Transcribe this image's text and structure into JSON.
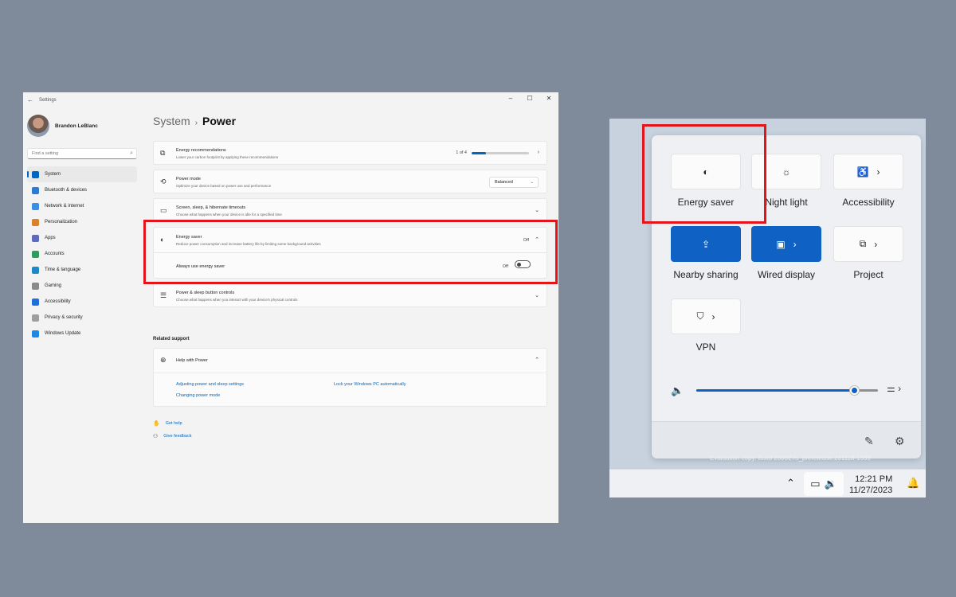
{
  "settings": {
    "window_title": "Settings",
    "window_controls": [
      "–",
      "☐",
      "✕"
    ],
    "user_name": "Brandon LeBlanc",
    "search_placeholder": "Find a setting",
    "nav": [
      {
        "label": "System",
        "color": "#0067c0"
      },
      {
        "label": "Bluetooth & devices",
        "color": "#2b7bd6"
      },
      {
        "label": "Network & internet",
        "color": "#3a8ee6"
      },
      {
        "label": "Personalization",
        "color": "#d9822b"
      },
      {
        "label": "Apps",
        "color": "#5c6bc0"
      },
      {
        "label": "Accounts",
        "color": "#2e9c5a"
      },
      {
        "label": "Time & language",
        "color": "#1e88c7"
      },
      {
        "label": "Gaming",
        "color": "#8a8a8a"
      },
      {
        "label": "Accessibility",
        "color": "#1e6fd9"
      },
      {
        "label": "Privacy & security",
        "color": "#9e9e9e"
      },
      {
        "label": "Windows Update",
        "color": "#1e88e5"
      }
    ],
    "breadcrumb": {
      "parent": "System",
      "current": "Power"
    },
    "cards": {
      "energy_recs": {
        "title": "Energy recommendations",
        "subtitle": "Lower your carbon footprint by applying these recommendations",
        "progress_text": "1 of 4",
        "progress_fraction": 0.25
      },
      "power_mode": {
        "title": "Power mode",
        "subtitle": "Optimize your device based on power use and performance",
        "value": "Balanced"
      },
      "screen_sleep": {
        "title": "Screen, sleep, & hibernate timeouts",
        "subtitle": "Choose what happens when your device is idle for a specified time"
      },
      "energy_saver": {
        "title": "Energy saver",
        "subtitle": "Reduce power consumption and increase battery life by limiting some background activities",
        "state": "Off"
      },
      "always_energy_saver": {
        "title": "Always use energy saver",
        "state": "Off"
      },
      "power_buttons": {
        "title": "Power & sleep button controls",
        "subtitle": "Choose what happens when you interact with your device's physical controls"
      }
    },
    "related_support": {
      "heading": "Related support",
      "help_title": "Help with Power",
      "links": [
        "Adjusting power and sleep settings",
        "Lock your Windows PC automatically",
        "Changing power mode"
      ]
    },
    "footer_links": [
      "Get help",
      "Give feedback"
    ]
  },
  "quick_settings": {
    "tiles": [
      {
        "label": "Energy saver",
        "icon": "battery-leaf-icon",
        "active": false
      },
      {
        "label": "Night light",
        "icon": "sun-icon",
        "active": false
      },
      {
        "label": "Accessibility",
        "icon": "accessibility-icon",
        "active": false
      },
      {
        "label": "Nearby sharing",
        "icon": "share-icon",
        "active": true
      },
      {
        "label": "Wired display",
        "icon": "cast-icon",
        "active": true
      },
      {
        "label": "Project",
        "icon": "project-icon",
        "active": false
      },
      {
        "label": "VPN",
        "icon": "shield-icon",
        "active": false
      }
    ],
    "volume_fraction": 0.87,
    "ghost_text": "Evaluation copy. Build 26002.rs_prerelease.231118-1559",
    "taskbar": {
      "time": "12:21 PM",
      "date": "11/27/2023"
    }
  },
  "colors": {
    "accent": "#0067c0",
    "tile_active": "#0f62c4",
    "highlight": "#e3151b"
  }
}
